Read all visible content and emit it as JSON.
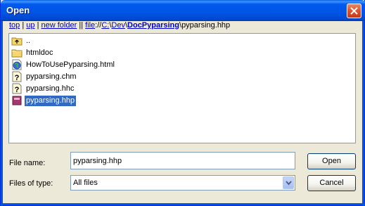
{
  "window": {
    "title": "Open"
  },
  "path_bar": {
    "top": "top",
    "sep1": " | ",
    "up": "up",
    "sep2": " | ",
    "new_folder": "new folder",
    "sep3": " || ",
    "file": "file",
    "scheme_sep": "://",
    "seg_c": "C:",
    "slash1": "\\",
    "seg_dev": "Dev",
    "slash2": "\\",
    "seg_doc": "DocPyparsing",
    "slash3": "\\",
    "current_file": "pyparsing.hhp"
  },
  "files": [
    {
      "name": "..",
      "icon": "parent-folder-icon",
      "selected": false
    },
    {
      "name": "htmldoc",
      "icon": "folder-icon",
      "selected": false
    },
    {
      "name": "HowToUsePyparsing.html",
      "icon": "html-file-icon",
      "selected": false
    },
    {
      "name": "pyparsing.chm",
      "icon": "help-file-icon",
      "selected": false
    },
    {
      "name": "pyparsing.hhc",
      "icon": "help-file-icon",
      "selected": false
    },
    {
      "name": "pyparsing.hhp",
      "icon": "help-project-icon",
      "selected": true
    }
  ],
  "form": {
    "file_name_label": "File name:",
    "file_name_value": "pyparsing.hhp",
    "file_type_label": "Files of type:",
    "file_type_value": "All files"
  },
  "buttons": {
    "open": "Open",
    "cancel": "Cancel"
  },
  "colors": {
    "title_bar": "#0055e5",
    "close_button": "#d8552e",
    "selection": "#316ac5",
    "link": "#0000cc"
  }
}
